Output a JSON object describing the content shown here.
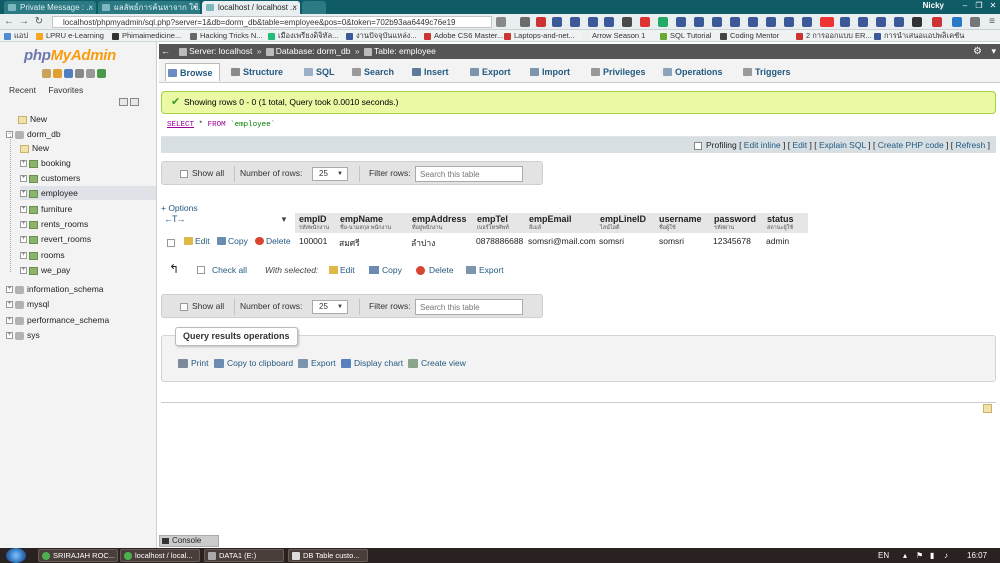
{
  "browser": {
    "tabs": [
      "Private Message : ...",
      "ผลลัพธ์การค้นหาจาก ใช้...",
      "localhost / localhost ...",
      ""
    ],
    "user": "Nicky",
    "address": "localhost/phpmyadmin/sql.php?server=1&db=dorm_db&table=employee&pos=0&token=702b93aa6449c76e19",
    "bookmarks": [
      "แอป",
      "LPRU e-Learning",
      "Phimaimedicine...",
      "Hacking Tricks N...",
      "เมืองเพรียงดิจิทัล...",
      "งานปัจจุบันแหล่ง...",
      "Adobe CS6 Master...",
      "Laptops-and-net...",
      "Arrow Season 1",
      "SQL Tutorial",
      "Coding Mentor",
      "2 การออกแบบ ER...",
      "การนำเสนอแอปพลิเคชัน"
    ]
  },
  "sidebar": {
    "logo_php": "php",
    "logo_myadmin": "MyAdmin",
    "recent": "Recent",
    "favorites": "Favorites",
    "new": "New",
    "databases": [
      {
        "name": "dorm_db",
        "expanded": true
      },
      {
        "name": "information_schema"
      },
      {
        "name": "mysql"
      },
      {
        "name": "performance_schema"
      },
      {
        "name": "sys"
      }
    ],
    "dorm_db_new": "New",
    "tables": [
      "booking",
      "customers",
      "employee",
      "furniture",
      "rents_rooms",
      "revert_rooms",
      "rooms",
      "we_pay"
    ],
    "selected_table": "employee"
  },
  "breadcrumb": {
    "server": "Server: localhost",
    "database": "Database: dorm_db",
    "table": "Table: employee"
  },
  "menu": [
    "Browse",
    "Structure",
    "SQL",
    "Search",
    "Insert",
    "Export",
    "Import",
    "Privileges",
    "Operations",
    "Triggers"
  ],
  "result": {
    "message": "Showing rows 0 - 0 (1 total, Query took 0.0010 seconds.)",
    "sql_kw1": "SELECT",
    "sql_star": "*",
    "sql_kw2": "FROM",
    "sql_table": "`employee`"
  },
  "profile_bar": {
    "profiling": "Profiling",
    "edit_inline": "Edit inline",
    "edit": "Edit",
    "explain": "Explain SQL",
    "create_php": "Create PHP code",
    "refresh": "Refresh"
  },
  "nav": {
    "show_all": "Show all",
    "number_of_rows": "Number of rows:",
    "rows_value": "25",
    "filter_rows": "Filter rows:",
    "search_placeholder": "Search this table"
  },
  "options_label": "+ Options",
  "columns": [
    {
      "name": "empID",
      "comment": "รหัสพนักงาน"
    },
    {
      "name": "empName",
      "comment": "ชื่อ-นามสกุล พนักงาน"
    },
    {
      "name": "empAddress",
      "comment": "ที่อยู่พนักงาน"
    },
    {
      "name": "empTel",
      "comment": "เบอร์โทรศัพท์"
    },
    {
      "name": "empEmail",
      "comment": "อีเมล์"
    },
    {
      "name": "empLineID",
      "comment": "ไลน์ไอดี"
    },
    {
      "name": "username",
      "comment": "ชื่อผู้ใช้"
    },
    {
      "name": "password",
      "comment": "รหัสผ่าน"
    },
    {
      "name": "status",
      "comment": "สถานะผู้ใช้"
    }
  ],
  "row_actions": {
    "edit": "Edit",
    "copy": "Copy",
    "delete": "Delete"
  },
  "rows": [
    [
      "100001",
      "สมศรี",
      "ลำปาง",
      "0878886688",
      "somsri@mail.com",
      "somsri",
      "somsri",
      "12345678",
      "admin"
    ]
  ],
  "with_selected": {
    "check_all": "Check all",
    "label": "With selected:",
    "edit": "Edit",
    "copy": "Copy",
    "delete": "Delete",
    "export": "Export"
  },
  "query_ops": {
    "title": "Query results operations",
    "print": "Print",
    "copy_clipboard": "Copy to clipboard",
    "export": "Export",
    "display_chart": "Display chart",
    "create_view": "Create view"
  },
  "console": "Console",
  "taskbar": {
    "items": [
      "SRIRAJAH ROC...",
      "localhost / local...",
      "DATA1 (E:)",
      "DB Table custo..."
    ],
    "lang": "EN",
    "time": "16:07"
  },
  "colors": {
    "link": "#235a81",
    "success_bg": "#ebf8a4",
    "header_bg": "#555555",
    "tab_strip": "#0f5c66"
  }
}
